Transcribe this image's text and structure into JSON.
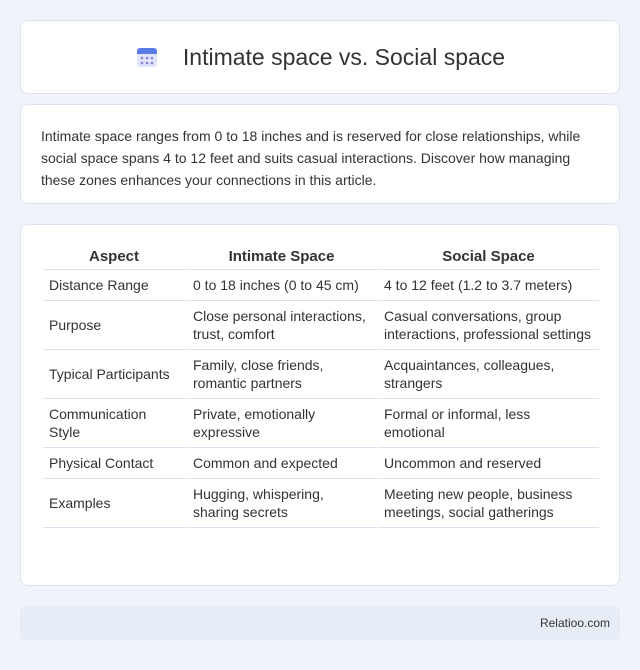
{
  "header": {
    "title": "Intimate space vs. Social space",
    "icon": "calendar-icon"
  },
  "intro": {
    "text": "Intimate space ranges from 0 to 18 inches and is reserved for close relationships, while social space spans 4 to 12 feet and suits casual interactions. Discover how managing these zones enhances your connections in this article."
  },
  "table": {
    "headers": [
      "Aspect",
      "Intimate Space",
      "Social Space"
    ],
    "rows": [
      [
        "Distance Range",
        "0 to 18 inches (0 to 45 cm)",
        "4 to 12 feet (1.2 to 3.7 meters)"
      ],
      [
        "Purpose",
        "Close personal interactions, trust, comfort",
        "Casual conversations, group interactions, professional settings"
      ],
      [
        "Typical Participants",
        "Family, close friends, romantic partners",
        "Acquaintances, colleagues, strangers"
      ],
      [
        "Communication Style",
        "Private, emotionally expressive",
        "Formal or informal, less emotional"
      ],
      [
        "Physical Contact",
        "Common and expected",
        "Uncommon and reserved"
      ],
      [
        "Examples",
        "Hugging, whispering, sharing secrets",
        "Meeting new people, business meetings, social gatherings"
      ]
    ]
  },
  "footer": {
    "brand": "Relatioo.com"
  }
}
